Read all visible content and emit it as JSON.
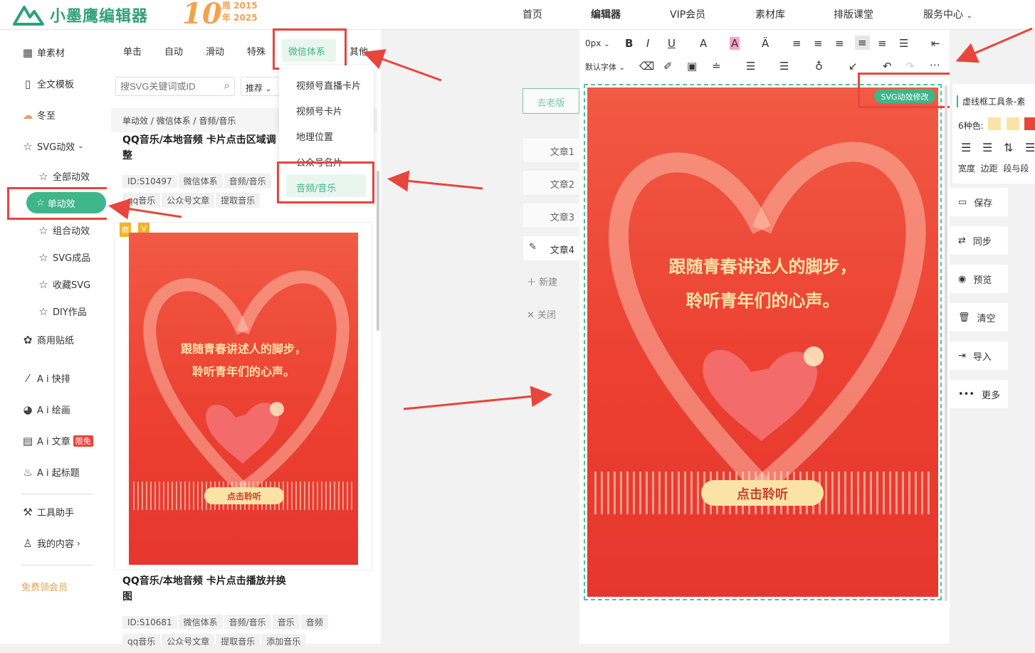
{
  "header": {
    "brand": "小墨鹰编辑器",
    "anniversary_number": "10",
    "anniversary_line1": "周 2015",
    "anniversary_line2": "年 2025",
    "nav": [
      "首页",
      "编辑器",
      "VIP会员",
      "素材库",
      "排版课堂",
      "服务中心"
    ]
  },
  "sidebar": {
    "items": [
      {
        "icon": "grid-icon",
        "label": "单素材"
      },
      {
        "icon": "template-icon",
        "label": "全文模板"
      },
      {
        "icon": "winter-icon",
        "label": "冬至"
      },
      {
        "icon": "star-icon",
        "label": "SVG动效"
      },
      {
        "icon": "star-icon",
        "label": "全部动效"
      },
      {
        "icon": "star-icon",
        "label": "单动效"
      },
      {
        "icon": "star-icon",
        "label": "组合动效"
      },
      {
        "icon": "star-icon",
        "label": "SVG成品"
      },
      {
        "icon": "star-icon",
        "label": "收藏SVG"
      },
      {
        "icon": "star-icon",
        "label": "DIY作品"
      },
      {
        "icon": "puzzle-icon",
        "label": "商用贴纸"
      },
      {
        "icon": "ai-icon",
        "label": "A i 快排"
      },
      {
        "icon": "palette-icon",
        "label": "A i 绘画"
      },
      {
        "icon": "doc-icon",
        "label": "A i 文章"
      },
      {
        "icon": "fire-icon",
        "label": "A i 起标题"
      },
      {
        "icon": "tool-icon",
        "label": "工具助手"
      },
      {
        "icon": "user-icon",
        "label": "我的内容"
      }
    ],
    "ai_badge": "限免",
    "free_vip": "免费领会员"
  },
  "panel": {
    "tabs": [
      "单击",
      "自动",
      "滑动",
      "特殊",
      "微信体系",
      "其他"
    ],
    "search_placeholder": "搜SVG关键词或ID",
    "sort_label": "推荐",
    "breadcrumb": [
      "单动效",
      "微信体系",
      "音频/音乐"
    ],
    "dropdown": [
      "视频号直播卡片",
      "视频号卡片",
      "地理位置",
      "公众号名片",
      "音频/音乐"
    ],
    "cards": [
      {
        "title": "QQ音乐/本地音频 卡片点击区域调整",
        "tags": [
          "ID:S10497",
          "微信体系",
          "音频/音乐",
          "qq音乐",
          "公众号文章",
          "提取音乐"
        ]
      },
      {
        "title": "QQ音乐/本地音频 卡片点击播放并换图",
        "tags": [
          "ID:S10681",
          "微信体系",
          "音频/音乐",
          "音乐",
          "音频",
          "qq音乐",
          "公众号文章",
          "提取音乐",
          "添加音乐"
        ]
      }
    ],
    "badge_shang": "商",
    "badge_v": "V"
  },
  "poster": {
    "line1": "跟随青春讲述人的脚步，",
    "line2": "聆听青年们的心声。",
    "button": "点击聆听"
  },
  "articles": {
    "back_old": "去老版",
    "list": [
      "文章1",
      "文章2",
      "文章3",
      "文章4"
    ],
    "new": "新建",
    "close": "关闭"
  },
  "toolbar": {
    "size": "0px",
    "font": "默认字体",
    "svg_edit": "SVG动效修改"
  },
  "rightpanel": {
    "dashed_toolbar": "虚线框工具条-素",
    "colors_label": "6种色:",
    "colors": [
      "#fbe3a8",
      "#fbe3a8",
      "#e8453c"
    ],
    "props": [
      "宽度",
      "边距",
      "段与段"
    ],
    "buttons": [
      "保存",
      "同步",
      "预览",
      "清空",
      "导入",
      "更多"
    ]
  }
}
